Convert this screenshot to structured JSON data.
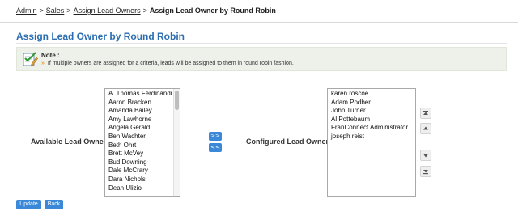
{
  "breadcrumb": {
    "items": [
      "Admin",
      "Sales",
      "Assign Lead Owners"
    ],
    "separator": ">",
    "current": "Assign Lead Owner by Round Robin"
  },
  "page_title": "Assign Lead Owner by Round Robin",
  "note": {
    "title": "Note :",
    "bullet": "»",
    "text": "If multiple owners are assigned for a criteria, leads will be assigned to them in round robin fashion."
  },
  "available": {
    "label": "Available Lead Owners :",
    "options": [
      "A. Thomas Ferdinandi",
      "Aaron Bracken",
      "Amanda Bailey",
      "Amy Lawhorne",
      "Angela Gerald",
      "Ben Wachter",
      "Beth Ohrt",
      "Brett McVey",
      "Bud Downing",
      "Dale McCrary",
      "Dara Nichols",
      "Dean Ulizio"
    ]
  },
  "transfer": {
    "add": ">>",
    "remove": "<<"
  },
  "configured": {
    "label": "Configured Lead Owners :",
    "options": [
      "karen roscoe",
      "Adam Podber",
      "John Turner",
      "Al Pottebaum",
      "FranConnect Administrator",
      "joseph reist"
    ]
  },
  "order_icons": [
    "move-top-icon",
    "move-up-icon",
    "move-down-icon",
    "move-bottom-icon"
  ],
  "buttons": {
    "update": "Update",
    "back": "Back"
  },
  "colors": {
    "accent": "#3b88d8",
    "title": "#2a6db1",
    "bullet": "#e07b00"
  }
}
